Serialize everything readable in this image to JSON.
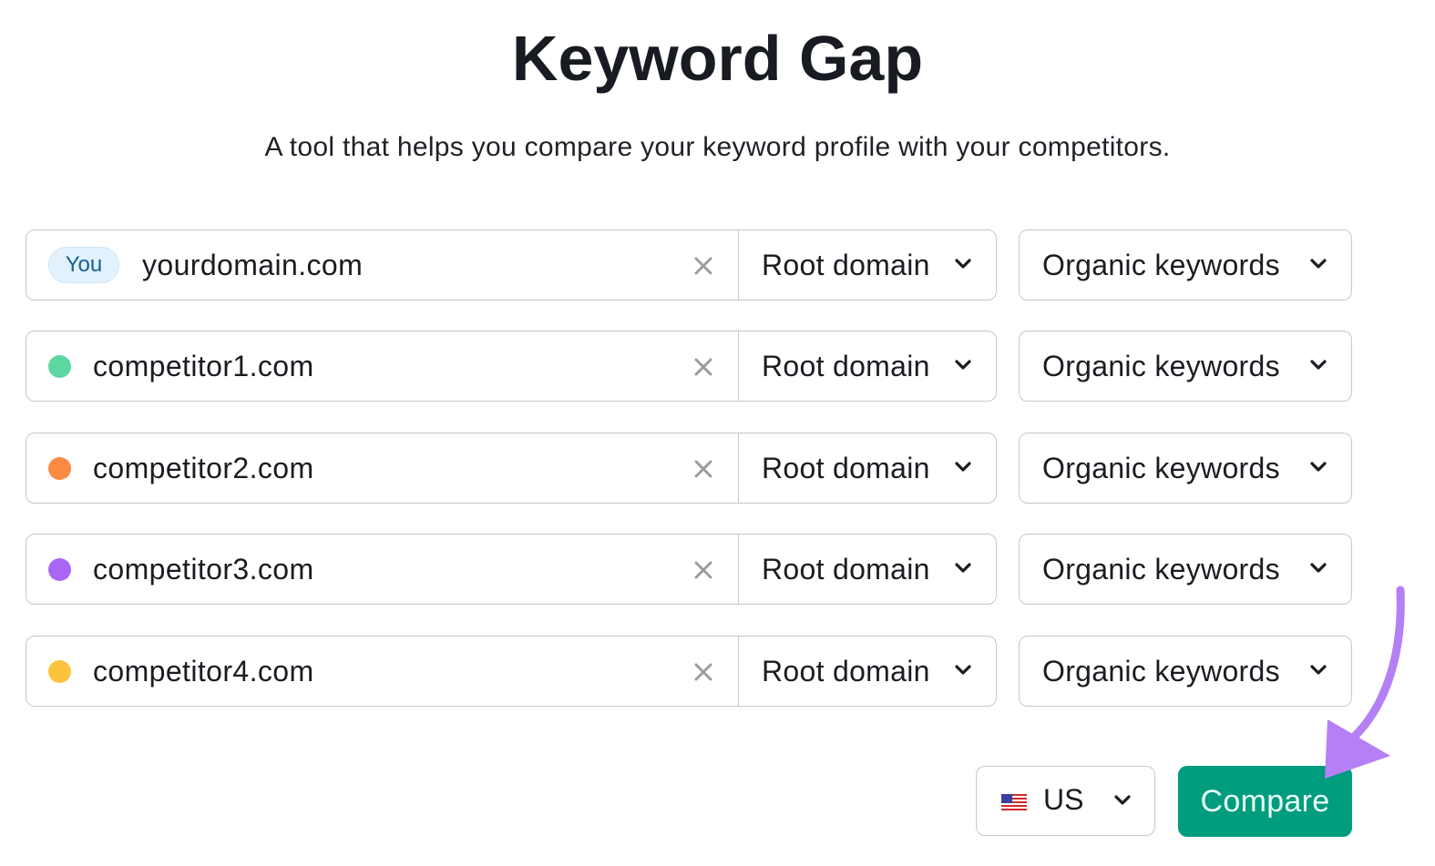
{
  "header": {
    "title": "Keyword Gap",
    "subtitle": "A tool that helps you compare your keyword profile with your competitors."
  },
  "rows": [
    {
      "badge": "You",
      "domain": "yourdomain.com",
      "marker": "you-badge",
      "type": "Root domain",
      "database": "Organic keywords",
      "clear_icon": "close-icon"
    },
    {
      "color": "#5dd6a2",
      "domain": "competitor1.com",
      "type": "Root domain",
      "database": "Organic keywords",
      "clear_icon": "close-icon"
    },
    {
      "color": "#fb8a42",
      "domain": "competitor2.com",
      "type": "Root domain",
      "database": "Organic keywords",
      "clear_icon": "close-icon"
    },
    {
      "color": "#a767f4",
      "domain": "competitor3.com",
      "type": "Root domain",
      "database": "Organic keywords",
      "clear_icon": "close-icon"
    },
    {
      "color": "#fcc33d",
      "domain": "competitor4.com",
      "type": "Root domain",
      "database": "Organic keywords",
      "clear_icon": "close-icon"
    }
  ],
  "footer": {
    "country": "US",
    "country_flag": "us-flag-icon",
    "compare_label": "Compare"
  },
  "colors": {
    "compare_button": "#009c7e",
    "annotation_arrow": "#b57ff6",
    "you_badge_bg": "#e2f1fc",
    "you_badge_text": "#175f95"
  }
}
